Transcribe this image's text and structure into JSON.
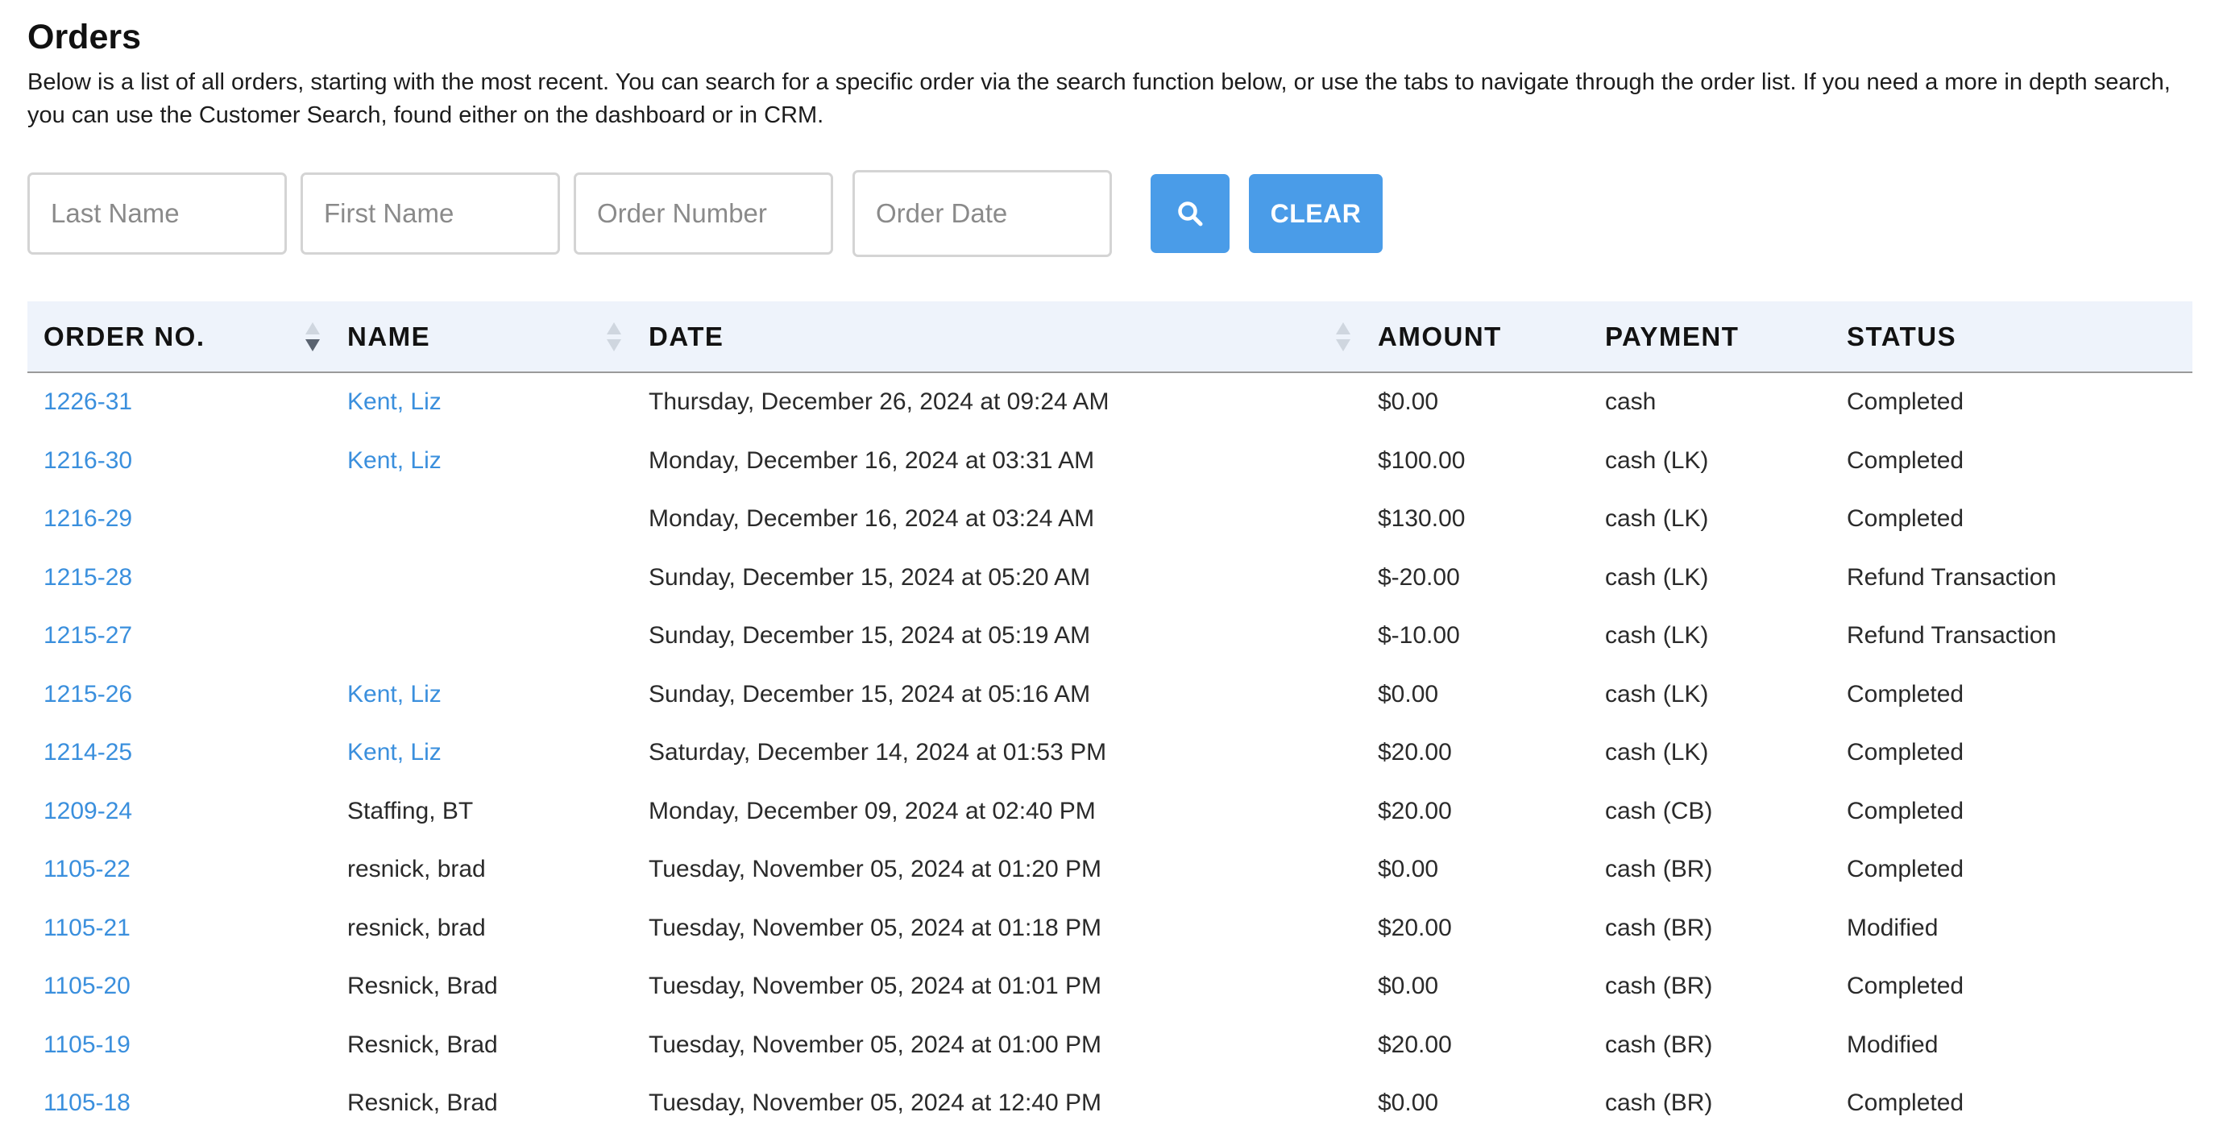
{
  "page": {
    "title": "Orders",
    "description": "Below is a list of all orders, starting with the most recent. You can search for a specific order via the search function below, or use the tabs to navigate through the order list. If you need a more in depth search, you can use the Customer Search, found either on the dashboard or in CRM."
  },
  "search": {
    "last_name_placeholder": "Last Name",
    "first_name_placeholder": "First Name",
    "order_number_placeholder": "Order Number",
    "order_date_placeholder": "Order Date",
    "search_icon": "search-icon",
    "clear_label": "CLEAR"
  },
  "colors": {
    "accent": "#4a9ce8",
    "link": "#3a8fdd",
    "header_bg": "#eef3fb"
  },
  "table": {
    "columns": [
      "ORDER NO.",
      "NAME",
      "DATE",
      "AMOUNT",
      "PAYMENT",
      "STATUS"
    ],
    "sort": {
      "column": "ORDER NO.",
      "direction": "descending"
    },
    "rows": [
      {
        "order_no": "1226-31",
        "name": "Kent, Liz",
        "name_link": true,
        "date": "Thursday, December 26, 2024 at 09:24 AM",
        "amount": "$0.00",
        "payment": "cash",
        "status": "Completed"
      },
      {
        "order_no": "1216-30",
        "name": "Kent, Liz",
        "name_link": true,
        "date": "Monday, December 16, 2024 at 03:31 AM",
        "amount": "$100.00",
        "payment": "cash (LK)",
        "status": "Completed"
      },
      {
        "order_no": "1216-29",
        "name": "",
        "name_link": false,
        "date": "Monday, December 16, 2024 at 03:24 AM",
        "amount": "$130.00",
        "payment": "cash (LK)",
        "status": "Completed"
      },
      {
        "order_no": "1215-28",
        "name": "",
        "name_link": false,
        "date": "Sunday, December 15, 2024 at 05:20 AM",
        "amount": "$-20.00",
        "payment": "cash (LK)",
        "status": "Refund Transaction"
      },
      {
        "order_no": "1215-27",
        "name": "",
        "name_link": false,
        "date": "Sunday, December 15, 2024 at 05:19 AM",
        "amount": "$-10.00",
        "payment": "cash (LK)",
        "status": "Refund Transaction"
      },
      {
        "order_no": "1215-26",
        "name": "Kent, Liz",
        "name_link": true,
        "date": "Sunday, December 15, 2024 at 05:16 AM",
        "amount": "$0.00",
        "payment": "cash (LK)",
        "status": "Completed"
      },
      {
        "order_no": "1214-25",
        "name": "Kent, Liz",
        "name_link": true,
        "date": "Saturday, December 14, 2024 at 01:53 PM",
        "amount": "$20.00",
        "payment": "cash (LK)",
        "status": "Completed"
      },
      {
        "order_no": "1209-24",
        "name": "Staffing, BT",
        "name_link": false,
        "date": "Monday, December 09, 2024 at 02:40 PM",
        "amount": "$20.00",
        "payment": "cash (CB)",
        "status": "Completed"
      },
      {
        "order_no": "1105-22",
        "name": "resnick, brad",
        "name_link": false,
        "date": "Tuesday, November 05, 2024 at 01:20 PM",
        "amount": "$0.00",
        "payment": "cash (BR)",
        "status": "Completed"
      },
      {
        "order_no": "1105-21",
        "name": "resnick, brad",
        "name_link": false,
        "date": "Tuesday, November 05, 2024 at 01:18 PM",
        "amount": "$20.00",
        "payment": "cash (BR)",
        "status": "Modified"
      },
      {
        "order_no": "1105-20",
        "name": "Resnick, Brad",
        "name_link": false,
        "date": "Tuesday, November 05, 2024 at 01:01 PM",
        "amount": "$0.00",
        "payment": "cash (BR)",
        "status": "Completed"
      },
      {
        "order_no": "1105-19",
        "name": "Resnick, Brad",
        "name_link": false,
        "date": "Tuesday, November 05, 2024 at 01:00 PM",
        "amount": "$20.00",
        "payment": "cash (BR)",
        "status": "Modified"
      },
      {
        "order_no": "1105-18",
        "name": "Resnick, Brad",
        "name_link": false,
        "date": "Tuesday, November 05, 2024 at 12:40 PM",
        "amount": "$0.00",
        "payment": "cash (BR)",
        "status": "Completed"
      }
    ]
  }
}
